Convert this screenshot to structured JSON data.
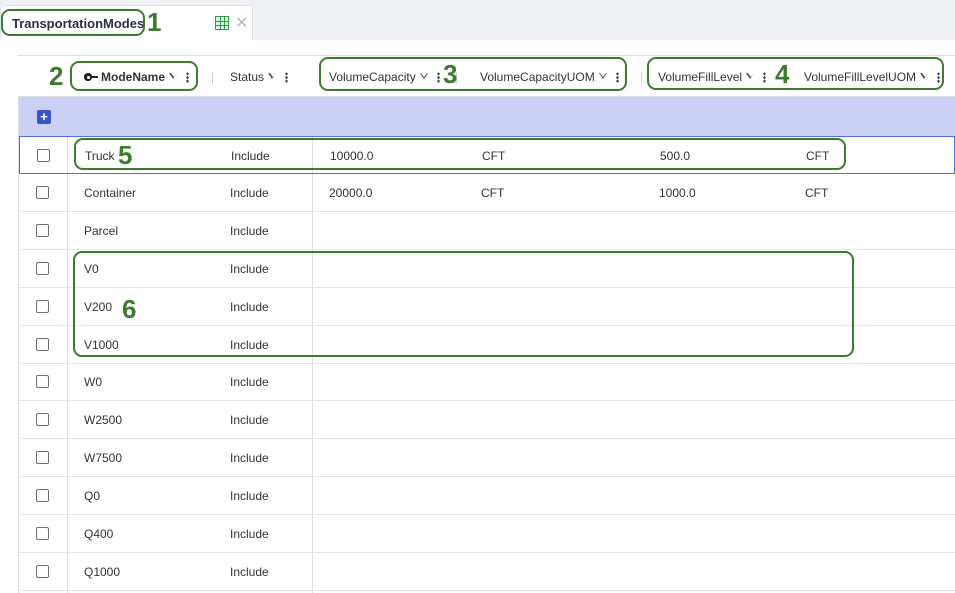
{
  "tab": {
    "title": "TransportationModes",
    "grid_icon": "table-grid-icon",
    "close_icon": "close-icon"
  },
  "columns": {
    "mode_name": "ModeName",
    "status": "Status",
    "volume_capacity": "VolumeCapacity",
    "volume_capacity_uom": "VolumeCapacityUOM",
    "volume_fill_level": "VolumeFillLevel",
    "volume_fill_level_uom": "VolumeFillLevelUOM"
  },
  "add_button": "+",
  "rows": [
    {
      "mode": "Truck",
      "status": "Include",
      "capacity": "10000.0",
      "capacity_uom": "CFT",
      "fill": "500.0",
      "fill_uom": "CFT"
    },
    {
      "mode": "Container",
      "status": "Include",
      "capacity": "20000.0",
      "capacity_uom": "CFT",
      "fill": "1000.0",
      "fill_uom": "CFT"
    },
    {
      "mode": "Parcel",
      "status": "Include",
      "capacity": "",
      "capacity_uom": "",
      "fill": "",
      "fill_uom": ""
    },
    {
      "mode": "V0",
      "status": "Include",
      "capacity": "",
      "capacity_uom": "",
      "fill": "",
      "fill_uom": ""
    },
    {
      "mode": "V200",
      "status": "Include",
      "capacity": "",
      "capacity_uom": "",
      "fill": "",
      "fill_uom": ""
    },
    {
      "mode": "V1000",
      "status": "Include",
      "capacity": "",
      "capacity_uom": "",
      "fill": "",
      "fill_uom": ""
    },
    {
      "mode": "W0",
      "status": "Include",
      "capacity": "",
      "capacity_uom": "",
      "fill": "",
      "fill_uom": ""
    },
    {
      "mode": "W2500",
      "status": "Include",
      "capacity": "",
      "capacity_uom": "",
      "fill": "",
      "fill_uom": ""
    },
    {
      "mode": "W7500",
      "status": "Include",
      "capacity": "",
      "capacity_uom": "",
      "fill": "",
      "fill_uom": ""
    },
    {
      "mode": "Q0",
      "status": "Include",
      "capacity": "",
      "capacity_uom": "",
      "fill": "",
      "fill_uom": ""
    },
    {
      "mode": "Q400",
      "status": "Include",
      "capacity": "",
      "capacity_uom": "",
      "fill": "",
      "fill_uom": ""
    },
    {
      "mode": "Q1000",
      "status": "Include",
      "capacity": "",
      "capacity_uom": "",
      "fill": "",
      "fill_uom": ""
    }
  ],
  "annotations": [
    "1",
    "2",
    "3",
    "4",
    "5",
    "6"
  ],
  "colors": {
    "annotation": "#3e7a30",
    "add_row_band": "#ccd0f4",
    "add_button": "#3a55c4",
    "grid_icon": "#2e9b48"
  }
}
